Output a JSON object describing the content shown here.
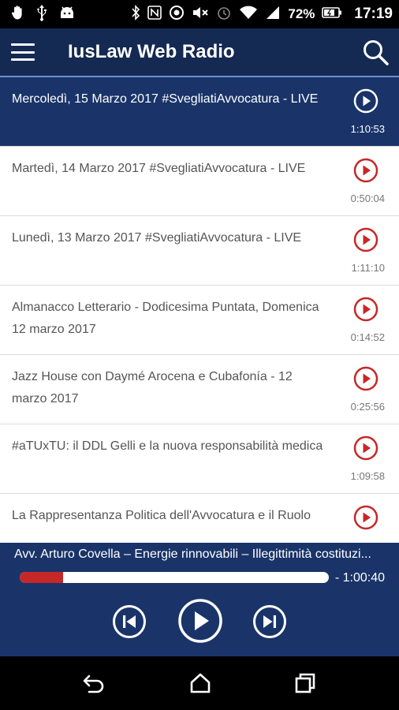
{
  "status_bar": {
    "battery": "72%",
    "time": "17:19",
    "icons_left": [
      "hand-icon",
      "usb-icon",
      "android-icon"
    ],
    "icons_right": [
      "bluetooth-icon",
      "nfc-icon",
      "sync-icon",
      "mute-icon",
      "alarm-icon",
      "wifi-icon",
      "signal-icon",
      "battery-icon"
    ]
  },
  "app_bar": {
    "title": "IusLaw Web Radio",
    "menu_icon": "menu-icon",
    "search_icon": "search-icon"
  },
  "episodes": [
    {
      "title": "Mercoledì, 15 Marzo 2017 #SvegliatiAvvocatura - LIVE",
      "duration": "1:10:53",
      "active": true
    },
    {
      "title": "Martedì, 14 Marzo 2017 #SvegliatiAvvocatura - LIVE",
      "duration": "0:50:04",
      "active": false
    },
    {
      "title": "Lunedì, 13 Marzo 2017 #SvegliatiAvvocatura - LIVE",
      "duration": "1:11:10",
      "active": false
    },
    {
      "title": "Almanacco Letterario - Dodicesima Puntata, Domenica 12 marzo 2017",
      "duration": "0:14:52",
      "active": false
    },
    {
      "title": "Jazz House con Daymé Arocena e Cubafonía - 12 marzo 2017",
      "duration": "0:25:56",
      "active": false
    },
    {
      "title": "#aTUxTU: il DDL Gelli e la nuova responsabilità medica",
      "duration": "1:09:58",
      "active": false
    },
    {
      "title": "La Rappresentanza Politica dell'Avvocatura e il Ruolo",
      "duration": "",
      "active": false
    }
  ],
  "player": {
    "now_playing": "Avv. Arturo Covella – Energie rinnovabili – Illegittimità costituzi...",
    "remaining": "- 1:00:40",
    "progress_fraction": 0.14,
    "colors": {
      "progress_fill": "#c62828",
      "background": "#1a3469"
    }
  },
  "colors": {
    "app_bar": "#142a52",
    "active_row": "#1a3469",
    "play_icon_red": "#c62828"
  }
}
